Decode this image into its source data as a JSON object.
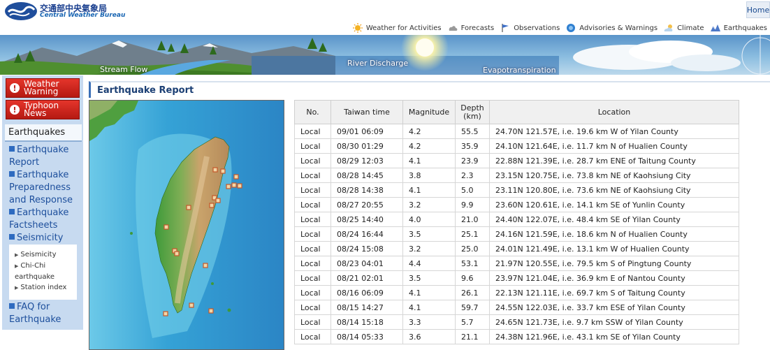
{
  "header": {
    "logo_zh": "交通部中央氣象局",
    "logo_en": "Central Weather Bureau",
    "home": "Home",
    "nav": [
      {
        "label": "Weather for Activities",
        "icon": "sun-icon",
        "color": "#f0a21a"
      },
      {
        "label": "Forecasts",
        "icon": "cloud-forecast-icon",
        "color": "#8a8a8a"
      },
      {
        "label": "Observations",
        "icon": "observation-flag-icon",
        "color": "#3c6fc8"
      },
      {
        "label": "Advisories & Warnings",
        "icon": "warning-globe-icon",
        "color": "#2f7fd0"
      },
      {
        "label": "Climate",
        "icon": "cloud-sun-icon",
        "color": "#9cc4e4"
      },
      {
        "label": "Earthquakes",
        "icon": "earthquake-icon",
        "color": "#4d79c8"
      }
    ]
  },
  "banner": {
    "labels": [
      "Stream Flow",
      "River Discharge",
      "Evapotranspiration"
    ]
  },
  "sidebar": {
    "weather_warning": "Weather Warning",
    "typhoon_news": "Typhoon News",
    "section_title": "Earthquakes",
    "links": [
      "Earthquake Report",
      "Earthquake Preparedness and Response",
      "Earthquake Factsheets",
      "Seismicity"
    ],
    "sub_items": [
      "Seismicity",
      "Chi-Chi earthquake",
      "Station index"
    ],
    "faq": "FAQ for Earthquake"
  },
  "main": {
    "title": "Earthquake Report",
    "table": {
      "headers": {
        "no": "No.",
        "time": "Taiwan time",
        "magnitude": "Magnitude",
        "depth": "Depth (km)",
        "location": "Location"
      },
      "rows": [
        {
          "no": "Local",
          "time": "09/01 06:09",
          "mag": "4.2",
          "depth": "55.5",
          "loc": "24.70N 121.57E, i.e. 19.6 km W of Yilan County"
        },
        {
          "no": "Local",
          "time": "08/30 01:29",
          "mag": "4.2",
          "depth": "35.9",
          "loc": "24.10N 121.64E, i.e. 11.7 km N of Hualien County"
        },
        {
          "no": "Local",
          "time": "08/29 12:03",
          "mag": "4.1",
          "depth": "23.9",
          "loc": "22.88N 121.39E, i.e. 28.7 km ENE of Taitung County"
        },
        {
          "no": "Local",
          "time": "08/28 14:45",
          "mag": "3.8",
          "depth": "2.3",
          "loc": "23.15N 120.75E, i.e. 73.8 km NE of Kaohsiung City"
        },
        {
          "no": "Local",
          "time": "08/28 14:38",
          "mag": "4.1",
          "depth": "5.0",
          "loc": "23.11N 120.80E, i.e. 73.6 km NE of Kaohsiung City"
        },
        {
          "no": "Local",
          "time": "08/27 20:55",
          "mag": "3.2",
          "depth": "9.9",
          "loc": "23.60N 120.61E, i.e. 14.1 km SE of Yunlin County"
        },
        {
          "no": "Local",
          "time": "08/25 14:40",
          "mag": "4.0",
          "depth": "21.0",
          "loc": "24.40N 122.07E, i.e. 48.4 km SE of Yilan County"
        },
        {
          "no": "Local",
          "time": "08/24 16:44",
          "mag": "3.5",
          "depth": "25.1",
          "loc": "24.16N 121.59E, i.e. 18.6 km N of Hualien County"
        },
        {
          "no": "Local",
          "time": "08/24 15:08",
          "mag": "3.2",
          "depth": "25.0",
          "loc": "24.01N 121.49E, i.e. 13.1 km W of Hualien County"
        },
        {
          "no": "Local",
          "time": "08/23 04:01",
          "mag": "4.4",
          "depth": "53.1",
          "loc": "21.97N 120.55E, i.e. 79.5 km S of Pingtung County"
        },
        {
          "no": "Local",
          "time": "08/21 02:01",
          "mag": "3.5",
          "depth": "9.6",
          "loc": "23.97N 121.04E, i.e. 36.9 km E of Nantou County"
        },
        {
          "no": "Local",
          "time": "08/16 06:09",
          "mag": "4.1",
          "depth": "26.1",
          "loc": "22.13N 121.11E, i.e. 69.7 km S of Taitung County"
        },
        {
          "no": "Local",
          "time": "08/15 14:27",
          "mag": "4.1",
          "depth": "59.7",
          "loc": "24.55N 122.03E, i.e. 33.7 km ESE of Yilan County"
        },
        {
          "no": "Local",
          "time": "08/14 15:18",
          "mag": "3.3",
          "depth": "5.7",
          "loc": "24.65N 121.73E, i.e. 9.7 km SSW of Yilan County"
        },
        {
          "no": "Local",
          "time": "08/14 05:33",
          "mag": "3.6",
          "depth": "21.1",
          "loc": "24.38N 121.96E, i.e. 43.1 km SE of Yilan County"
        }
      ]
    }
  }
}
